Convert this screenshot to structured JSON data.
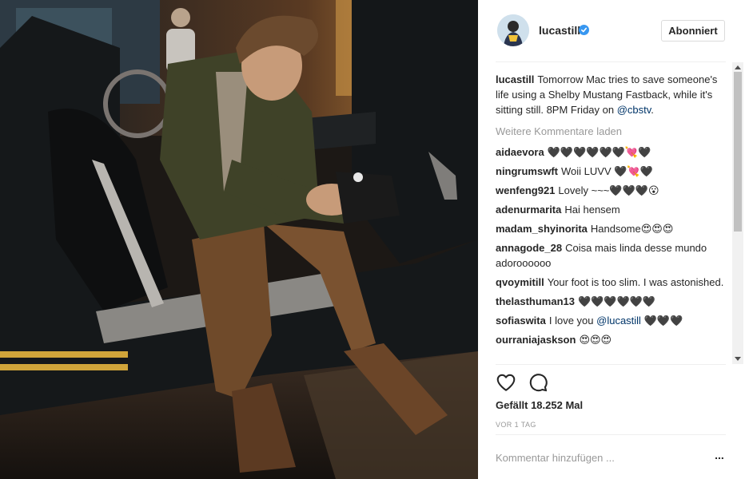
{
  "post": {
    "username": "lucastill",
    "follow_label": "Abonniert",
    "caption": "Tomorrow Mac tries to save someone's life using a Shelby Mustang Fastback, while it's sitting still. 8PM Friday on ",
    "caption_mention": "@cbstv",
    "caption_end": ".",
    "load_more": "Weitere Kommentare laden",
    "likes": "Gefällt 18.252 Mal",
    "timestamp": "VOR 1 TAG",
    "comment_placeholder": "Kommentar hinzufügen ...",
    "more_options": "..."
  },
  "comments": [
    {
      "user": "aidaevora",
      "text": "🖤🖤🖤🖤🖤🖤💘🖤"
    },
    {
      "user": "ningrumswft",
      "text": "Woii LUVV 🖤💘🖤"
    },
    {
      "user": "wenfeng921",
      "text": "Lovely ~~~🖤🖤🖤😮"
    },
    {
      "user": "adenurmarita",
      "text": "Hai hensem"
    },
    {
      "user": "madam_shyinorita",
      "text": "Handsome😍😍😍"
    },
    {
      "user": "annagode_28",
      "text": "Coisa mais linda desse mundo adoroooooo"
    },
    {
      "user": "qvoymitill",
      "text": "Your foot is too slim. I was astonished."
    },
    {
      "user": "thelasthuman13",
      "text": "🖤🖤🖤🖤🖤🖤"
    },
    {
      "user": "sofiaswita",
      "text": "I love you ",
      "mention": "@lucastill",
      "after": " 🖤🖤🖤"
    },
    {
      "user": "ourraniajaskson",
      "text": "😍😍😍"
    }
  ],
  "icons": {
    "verified": "verified-badge-icon",
    "like": "heart-outline-icon",
    "comment": "speech-bubble-icon",
    "more": "more-options-icon"
  },
  "colors": {
    "verified": "#3897f0",
    "mention": "#003569",
    "muted": "#999999"
  }
}
